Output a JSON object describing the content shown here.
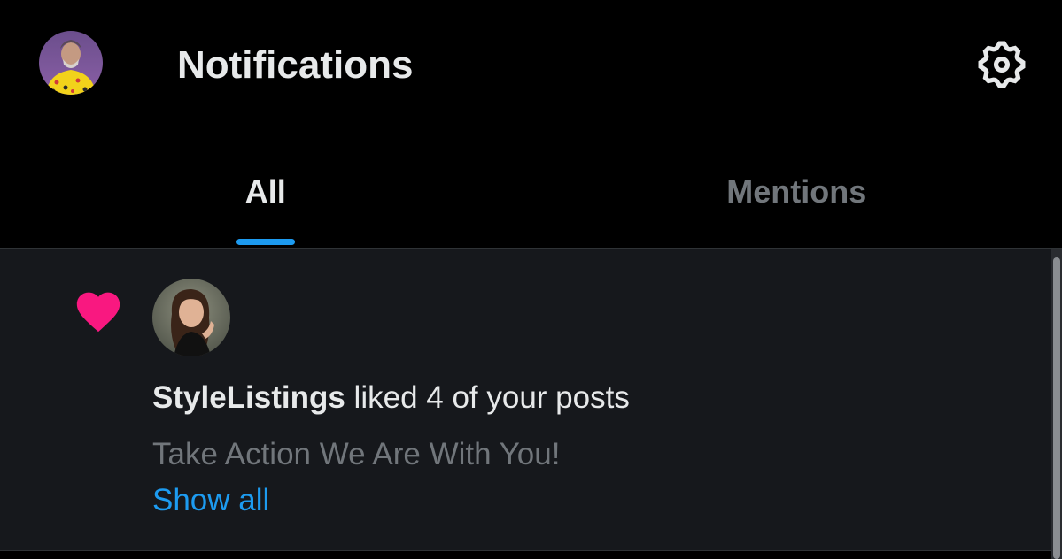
{
  "header": {
    "title": "Notifications",
    "avatar_icon": "profile-avatar",
    "settings_icon": "gear-icon"
  },
  "tabs": [
    {
      "label": "All",
      "active": true
    },
    {
      "label": "Mentions",
      "active": false
    }
  ],
  "notification": {
    "icon": "heart-icon",
    "icon_color": "#f91880",
    "username": "StyleListings",
    "action_text": " liked 4 of your posts",
    "preview_text": "Take Action We Are With You!",
    "show_all_label": "Show all"
  },
  "colors": {
    "accent": "#1d9bf0",
    "background": "#000000",
    "card_background": "#16181c",
    "primary_text": "#e7e9ea",
    "secondary_text": "#71767b"
  }
}
